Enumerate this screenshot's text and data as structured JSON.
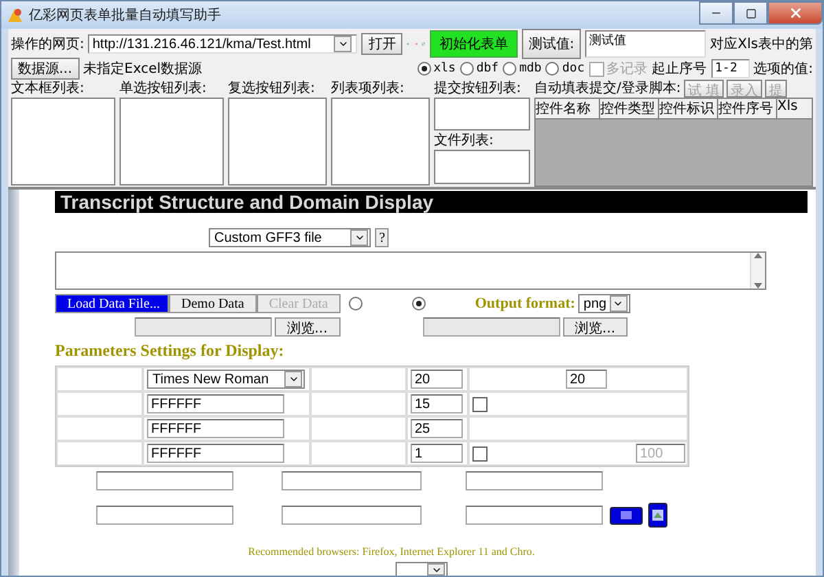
{
  "window": {
    "title": "亿彩网页表单批量自动填写助手"
  },
  "toolbar": {
    "url_label": "操作的网页:",
    "url": "http://131.216.46.121/kma/Test.html",
    "open_button": "打开",
    "init_button": "初始化表单",
    "test_label": "测试值:",
    "test_value": "测试值",
    "xls_row_label": "对应Xls表中的第"
  },
  "source": {
    "button": "数据源...",
    "status": "未指定Excel数据源",
    "formats": [
      {
        "label": "xls",
        "selected": true
      },
      {
        "label": "dbf",
        "selected": false
      },
      {
        "label": "mdb",
        "selected": false
      },
      {
        "label": "doc",
        "selected": false
      }
    ],
    "multi_record": {
      "label": "多记录",
      "checked": false,
      "disabled": true
    },
    "range_label": "起止序号",
    "range_value": "1-2",
    "option_label": "选项的值:"
  },
  "lists": [
    {
      "label": "文本框列表:"
    },
    {
      "label": "单选按钮列表:"
    },
    {
      "label": "复选按钮列表:"
    },
    {
      "label": "列表项列表:"
    }
  ],
  "submit_list": {
    "label": "提交按钮列表:"
  },
  "file_list": {
    "label": "文件列表:"
  },
  "script": {
    "label": "自动填表提交/登录脚本:",
    "buttons": [
      {
        "label": "试 填",
        "disabled": true
      },
      {
        "label": "录入",
        "disabled": true
      },
      {
        "label": "提",
        "disabled": true
      }
    ],
    "columns": [
      "控件名称",
      "控件类型",
      "控件标识",
      "控件序号",
      "Xls"
    ]
  },
  "page": {
    "title": "Transcript Structure and Domain Display",
    "file_type": "Custom GFF3 file",
    "help": "?",
    "load_button": "Load Data File...",
    "demo_button": "Demo Data",
    "clear_button": {
      "label": "Clear Data",
      "disabled": true
    },
    "modes": [
      {
        "selected": false
      },
      {
        "selected": true
      }
    ],
    "output_label": "Output format:",
    "output_format": "png",
    "browse_buttons": [
      "浏览...",
      "浏览..."
    ],
    "params_heading": "Parameters Settings for Display:",
    "param_rows": [
      {
        "field": {
          "kind": "select",
          "value": "Times New Roman"
        },
        "number": "20",
        "option": {
          "kind": "input",
          "value": "20"
        }
      },
      {
        "field": {
          "kind": "input",
          "value": "FFFFFF"
        },
        "number": "15",
        "option": {
          "kind": "checkbox",
          "checked": false
        }
      },
      {
        "field": {
          "kind": "input",
          "value": "FFFFFF"
        },
        "number": "25",
        "option": {
          "kind": "none"
        }
      },
      {
        "field": {
          "kind": "input",
          "value": "FFFFFF"
        },
        "number": "1",
        "option": {
          "kind": "checkbox_input",
          "checked": false,
          "value": "100",
          "disabled": true
        }
      }
    ],
    "browsers_note": "Recommended browsers: Firefox, Internet Explorer 11 and Chro."
  }
}
